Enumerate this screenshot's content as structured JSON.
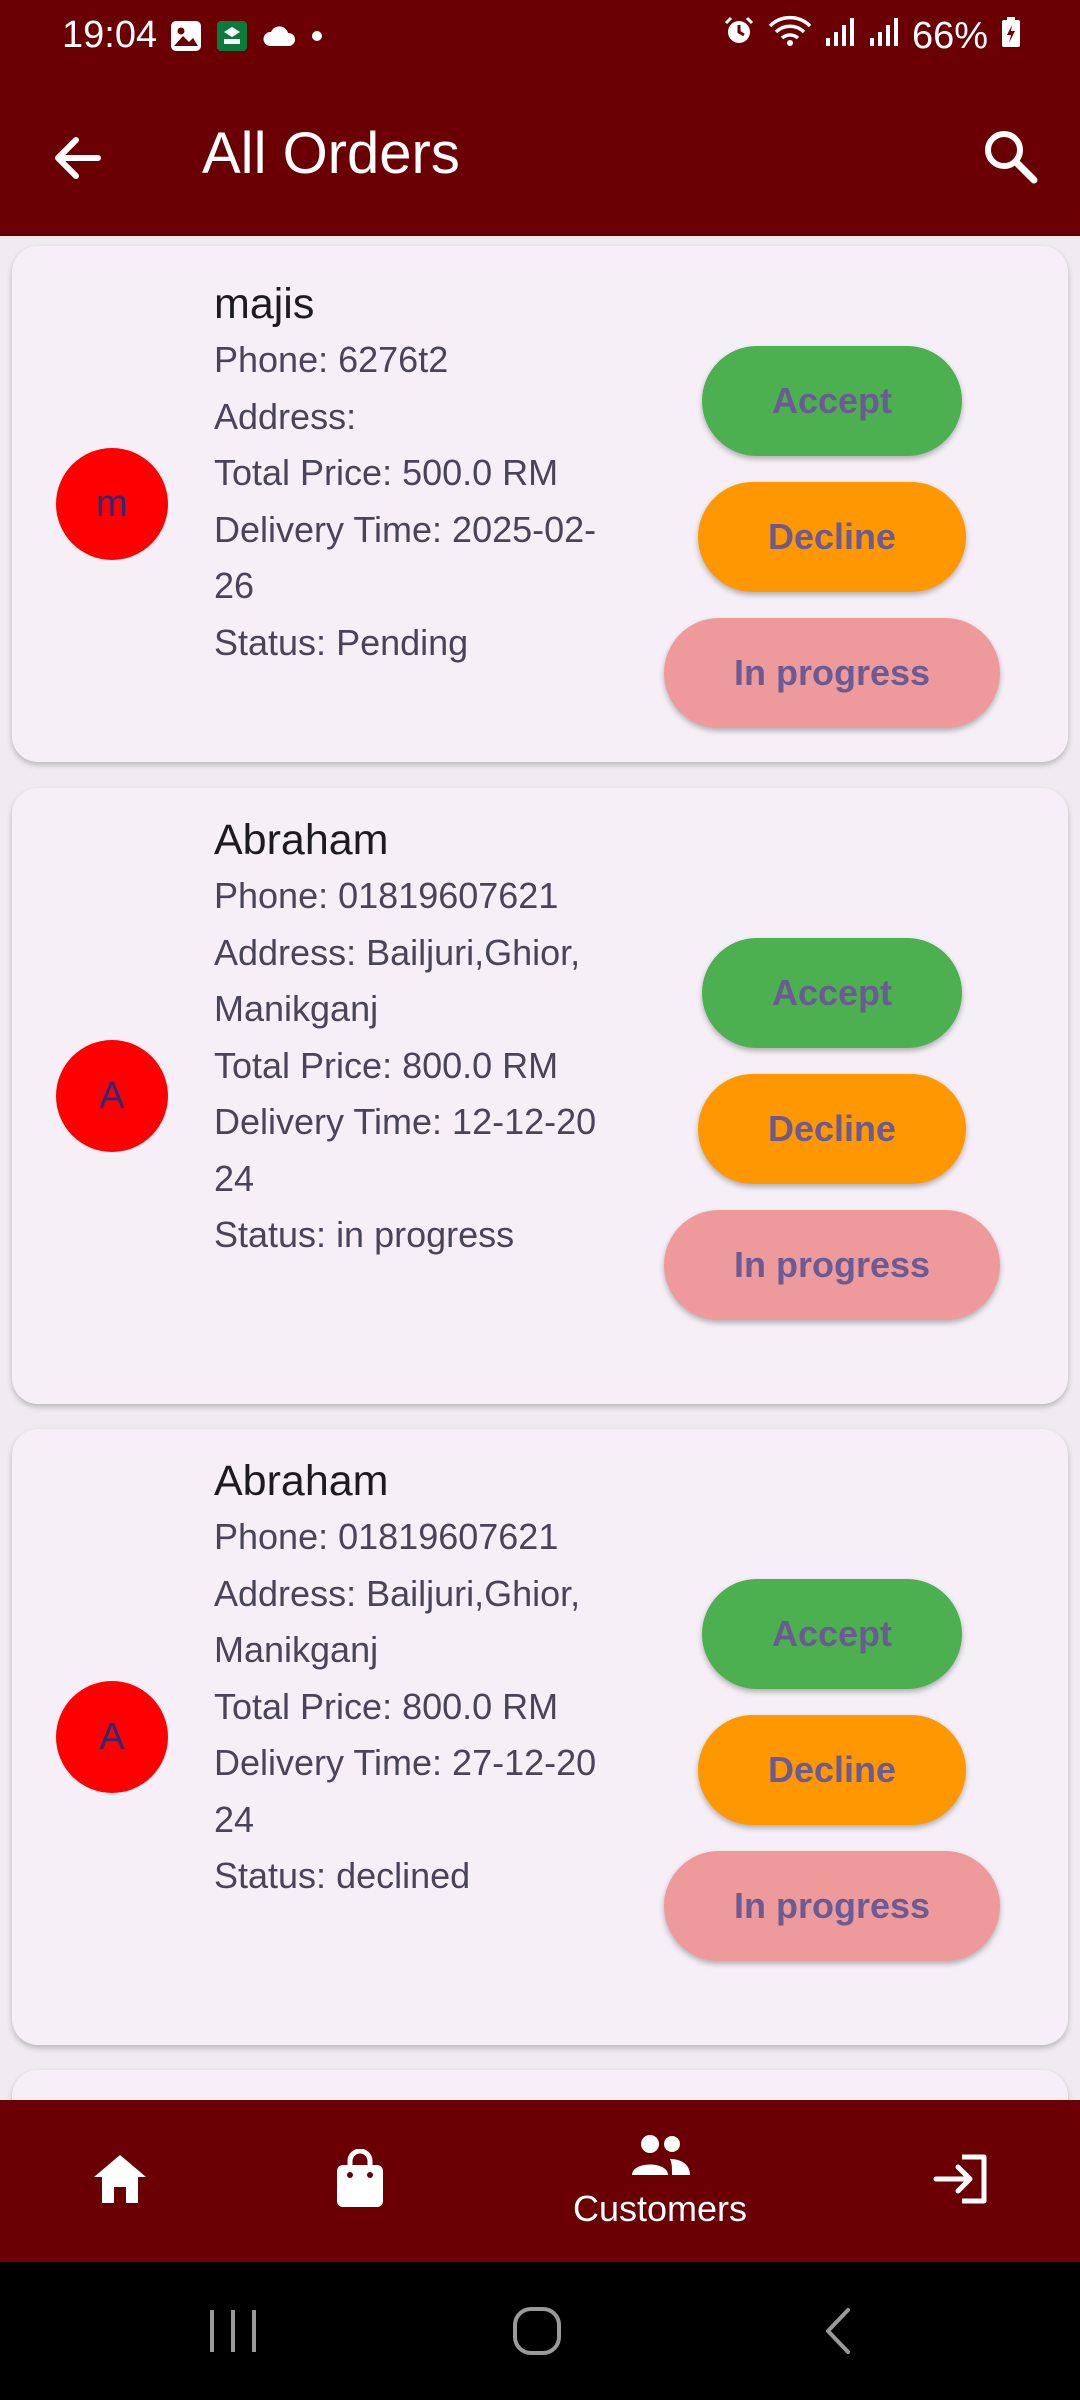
{
  "status_bar": {
    "time": "19:04",
    "battery": "66%"
  },
  "app_bar": {
    "title": "All Orders"
  },
  "orders": [
    {
      "initial": "m",
      "name": "majis",
      "details": [
        "Phone: 6276t2",
        "Address:",
        "Total Price: 500.0 RM",
        "Delivery Time: 2025-02-26",
        "Status: Pending"
      ],
      "accept_label": "Accept",
      "decline_label": "Decline",
      "progress_label": "In progress"
    },
    {
      "initial": "A",
      "name": "Abraham",
      "details": [
        "Phone: 01819607621",
        "Address: Bailjuri,Ghior,Manikganj",
        "Total Price: 800.0 RM",
        "Delivery Time: 12-12-2024",
        "Status: in progress"
      ],
      "accept_label": "Accept",
      "decline_label": "Decline",
      "progress_label": "In progress"
    },
    {
      "initial": "A",
      "name": "Abraham",
      "details": [
        "Phone: 01819607621",
        "Address: Bailjuri,Ghior,Manikganj",
        "Total Price: 800.0 RM",
        "Delivery Time: 27-12-2024",
        "Status: declined"
      ],
      "accept_label": "Accept",
      "decline_label": "Decline",
      "progress_label": "In progress"
    }
  ],
  "bottom_nav": {
    "items": [
      {
        "icon": "home-icon",
        "label": ""
      },
      {
        "icon": "shopping-bag-icon",
        "label": ""
      },
      {
        "icon": "people-icon",
        "label": "Customers"
      },
      {
        "icon": "logout-icon",
        "label": ""
      }
    ]
  },
  "colors": {
    "app_bar": "#6b0004",
    "card_bg": "#f6eff7",
    "avatar": "#ff0000",
    "accept": "#4caf50",
    "decline": "#ff9800",
    "in_progress": "#ee9a9b"
  }
}
